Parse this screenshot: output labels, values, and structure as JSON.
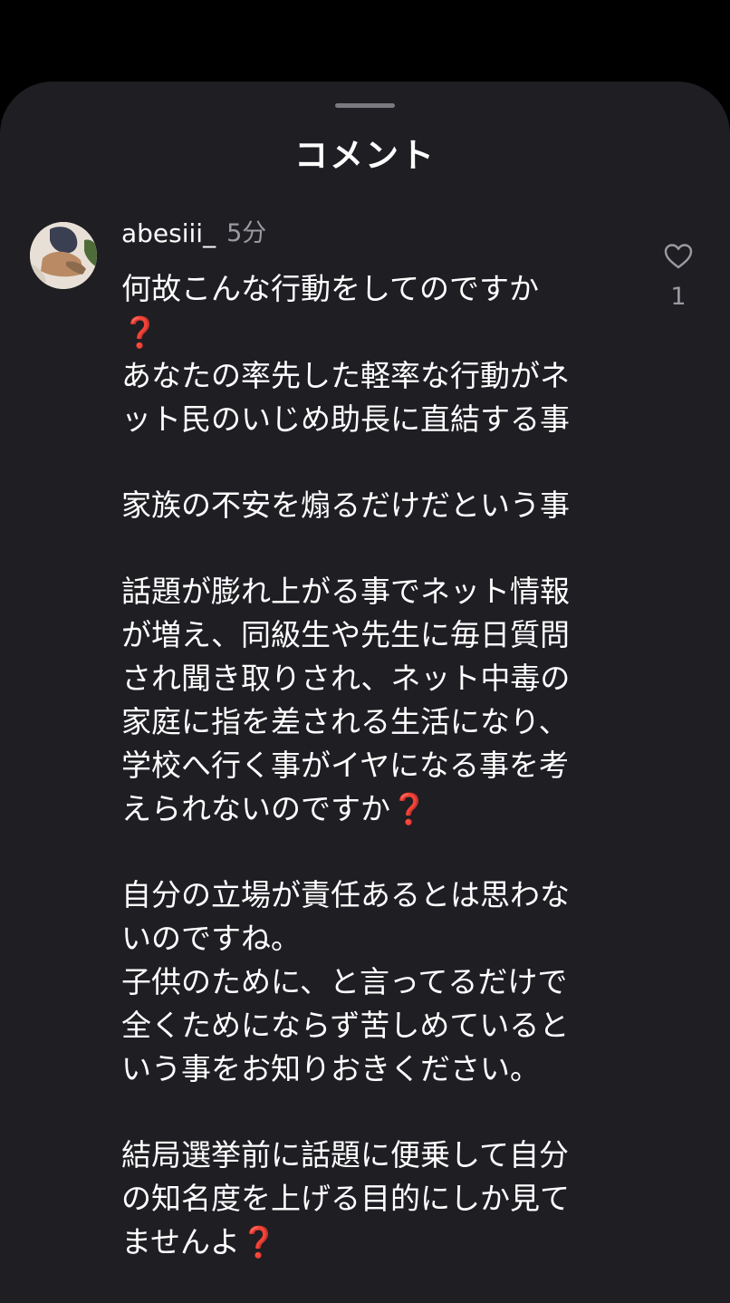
{
  "sheet": {
    "title": "コメント"
  },
  "comment": {
    "username": "abesiii_",
    "timestamp": "5分",
    "like_count": "1",
    "body_lines": [
      "何故こんな行動をしてのですか",
      "❓",
      "あなたの率先した軽率な行動がネ",
      "ット民のいじめ助長に直結する事",
      "",
      "家族の不安を煽るだけだという事",
      "",
      "話題が膨れ上がる事でネット情報",
      "が増え、同級生や先生に毎日質問",
      "され聞き取りされ、ネット中毒の",
      "家庭に指を差される生活になり、",
      "学校へ行く事がイヤになる事を考",
      "えられないのですか❓",
      "",
      "自分の立場が責任あるとは思わな",
      "いのですね。",
      "子供のために、と言ってるだけで",
      "全くためにならず苦しめていると",
      "いう事をお知りおきください。",
      "",
      "結局選挙前に話題に便乗して自分",
      "の知名度を上げる目的にしか見て",
      "ませんよ❓"
    ]
  },
  "icons": {
    "handle": "drag-handle",
    "like": "heart-outline-icon"
  },
  "colors": {
    "background": "#000000",
    "sheet": "#1e1e23",
    "text": "#ffffff",
    "secondary_text": "#9a9aa0",
    "question_mark": "#e0352b"
  }
}
